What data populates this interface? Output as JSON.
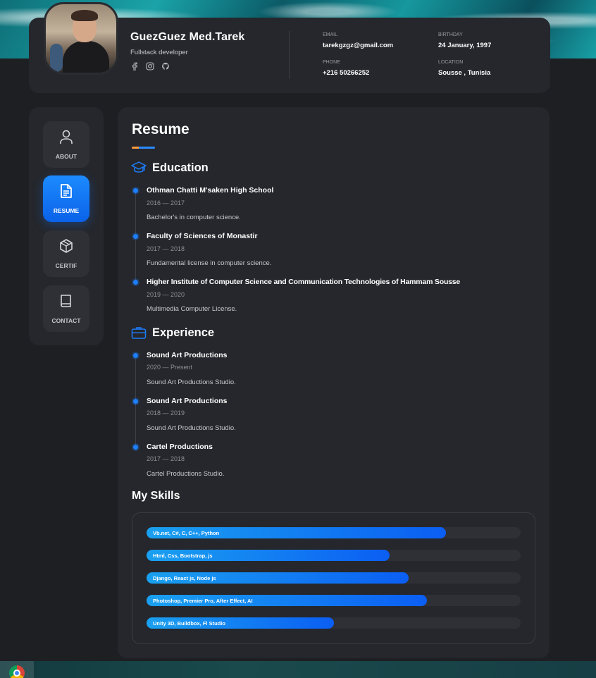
{
  "profile": {
    "name": "GuezGuez Med.Tarek",
    "role": "Fullstack developer",
    "socials": [
      "facebook-icon",
      "instagram-icon",
      "github-icon"
    ]
  },
  "contact_info": {
    "email_label": "EMAIL",
    "email": "tarekgzgz@gmail.com",
    "birthday_label": "BIRTHDAY",
    "birthday": "24 January, 1997",
    "phone_label": "PHONE",
    "phone": "+216 50266252",
    "location_label": "LOCATION",
    "location": "Sousse , Tunisia"
  },
  "nav": [
    {
      "label": "ABOUT",
      "icon": "user-icon",
      "active": false
    },
    {
      "label": "RESUME",
      "icon": "document-icon",
      "active": true
    },
    {
      "label": "CERTIF",
      "icon": "cube-icon",
      "active": false
    },
    {
      "label": "CONTACT",
      "icon": "book-icon",
      "active": false
    }
  ],
  "resume": {
    "title": "Resume",
    "education_title": "Education",
    "education": [
      {
        "title": "Othman Chatti M'saken High School",
        "date": "2016 — 2017",
        "desc": "Bachelor's in computer science."
      },
      {
        "title": "Faculty of Sciences of Monastir",
        "date": "2017 — 2018",
        "desc": "Fundamental license in computer science."
      },
      {
        "title": "Higher Institute of Computer Science and Communication Technologies of Hammam Sousse",
        "date": "2019 — 2020",
        "desc": "Multimedia Computer License."
      }
    ],
    "experience_title": "Experience",
    "experience": [
      {
        "title": "Sound Art Productions",
        "date": "2020 — Present",
        "desc": "Sound Art Productions Studio."
      },
      {
        "title": "Sound Art Productions",
        "date": "2018 — 2019",
        "desc": "Sound Art Productions Studio."
      },
      {
        "title": "Cartel Productions",
        "date": "2017 — 2018",
        "desc": "Cartel Productions Studio."
      }
    ],
    "skills_title": "My Skills",
    "skills": [
      {
        "label": "Vb.net, C#, C, C++, Python",
        "level": 0.8
      },
      {
        "label": "Html, Css, Bootstrap, js",
        "level": 0.65
      },
      {
        "label": "Django, React js, Node js",
        "level": 0.7
      },
      {
        "label": "Photoshop, Premier Pro, After Effect, AI",
        "level": 0.75
      },
      {
        "label": "Unity 3D, Buildbox, Fl Studio",
        "level": 0.5
      }
    ]
  },
  "colors": {
    "accent": "#1d7fff",
    "card": "#25272c",
    "background": "#1e1f23"
  }
}
